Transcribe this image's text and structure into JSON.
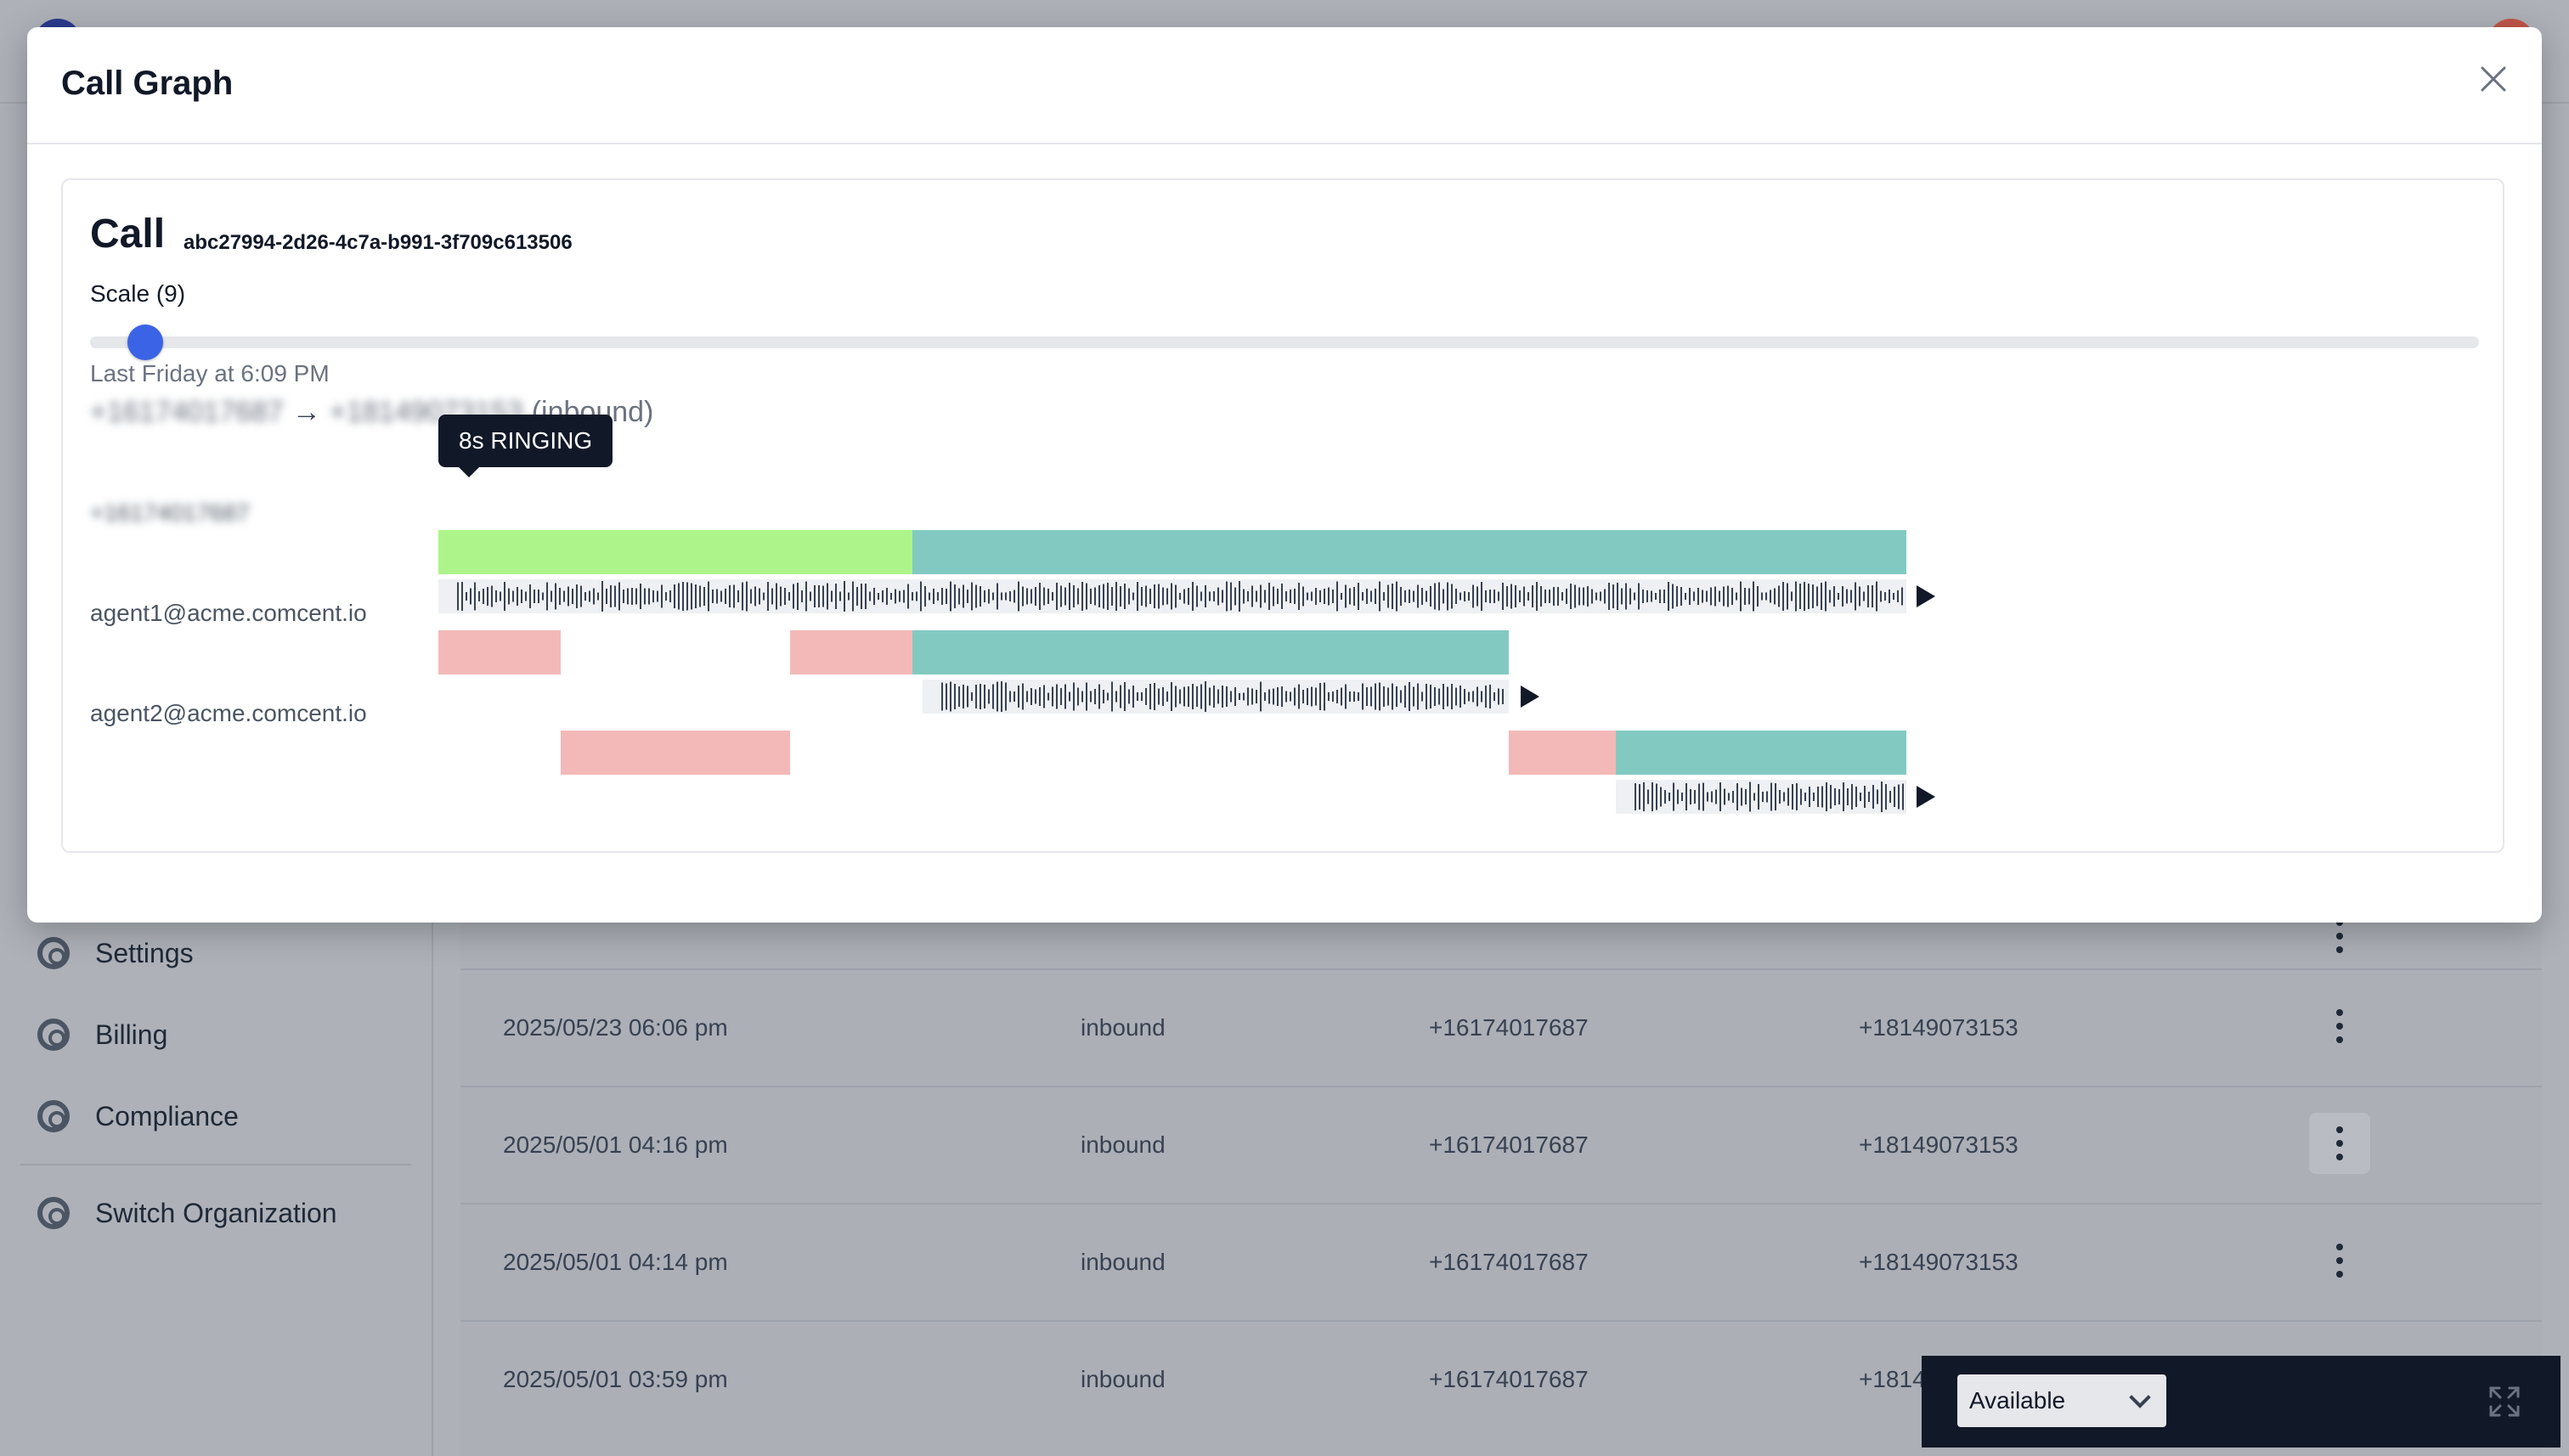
{
  "modal": {
    "title": "Call Graph",
    "close_icon": "close-icon"
  },
  "call": {
    "label": "Call",
    "id": "abc27994-2d26-4c7a-b991-3f709c613506",
    "scale_label": "Scale (9)",
    "scale_value": 9,
    "date": "Last Friday at 6:09 PM",
    "from_number": "+16174017687",
    "to_number": "+18149073153",
    "direction": "(inbound)"
  },
  "lanes": [
    {
      "label": "+16174017687",
      "blurred": true
    },
    {
      "label": "agent1@acme.comcent.io",
      "blurred": false
    },
    {
      "label": "agent2@acme.comcent.io",
      "blurred": false
    }
  ],
  "tooltip": {
    "text": "8s RINGING"
  },
  "colors": {
    "ringing": "#f3b9b8",
    "connected": "#82cac1",
    "ivr": "#adf58a",
    "slider": "#3b63e5"
  },
  "sidebar": {
    "items": [
      {
        "label": "Settings",
        "icon": "lifebuoy-icon"
      },
      {
        "label": "Billing",
        "icon": "lifebuoy-icon"
      },
      {
        "label": "Compliance",
        "icon": "lifebuoy-icon"
      },
      {
        "label": "Switch Organization",
        "icon": "lifebuoy-icon"
      }
    ]
  },
  "table": {
    "rows": [
      {
        "date": "2025/05/23 06:06 pm",
        "direction": "inbound",
        "from": "+16174017687",
        "to": "+18149073153"
      },
      {
        "date": "2025/05/01 04:16 pm",
        "direction": "inbound",
        "from": "+16174017687",
        "to": "+18149073153"
      },
      {
        "date": "2025/05/01 04:14 pm",
        "direction": "inbound",
        "from": "+16174017687",
        "to": "+18149073153"
      },
      {
        "date": "2025/05/01 03:59 pm",
        "direction": "inbound",
        "from": "+16174017687",
        "to": "+1814"
      }
    ]
  },
  "status_bar": {
    "status": "Available",
    "expand_icon": "expand-icon"
  }
}
